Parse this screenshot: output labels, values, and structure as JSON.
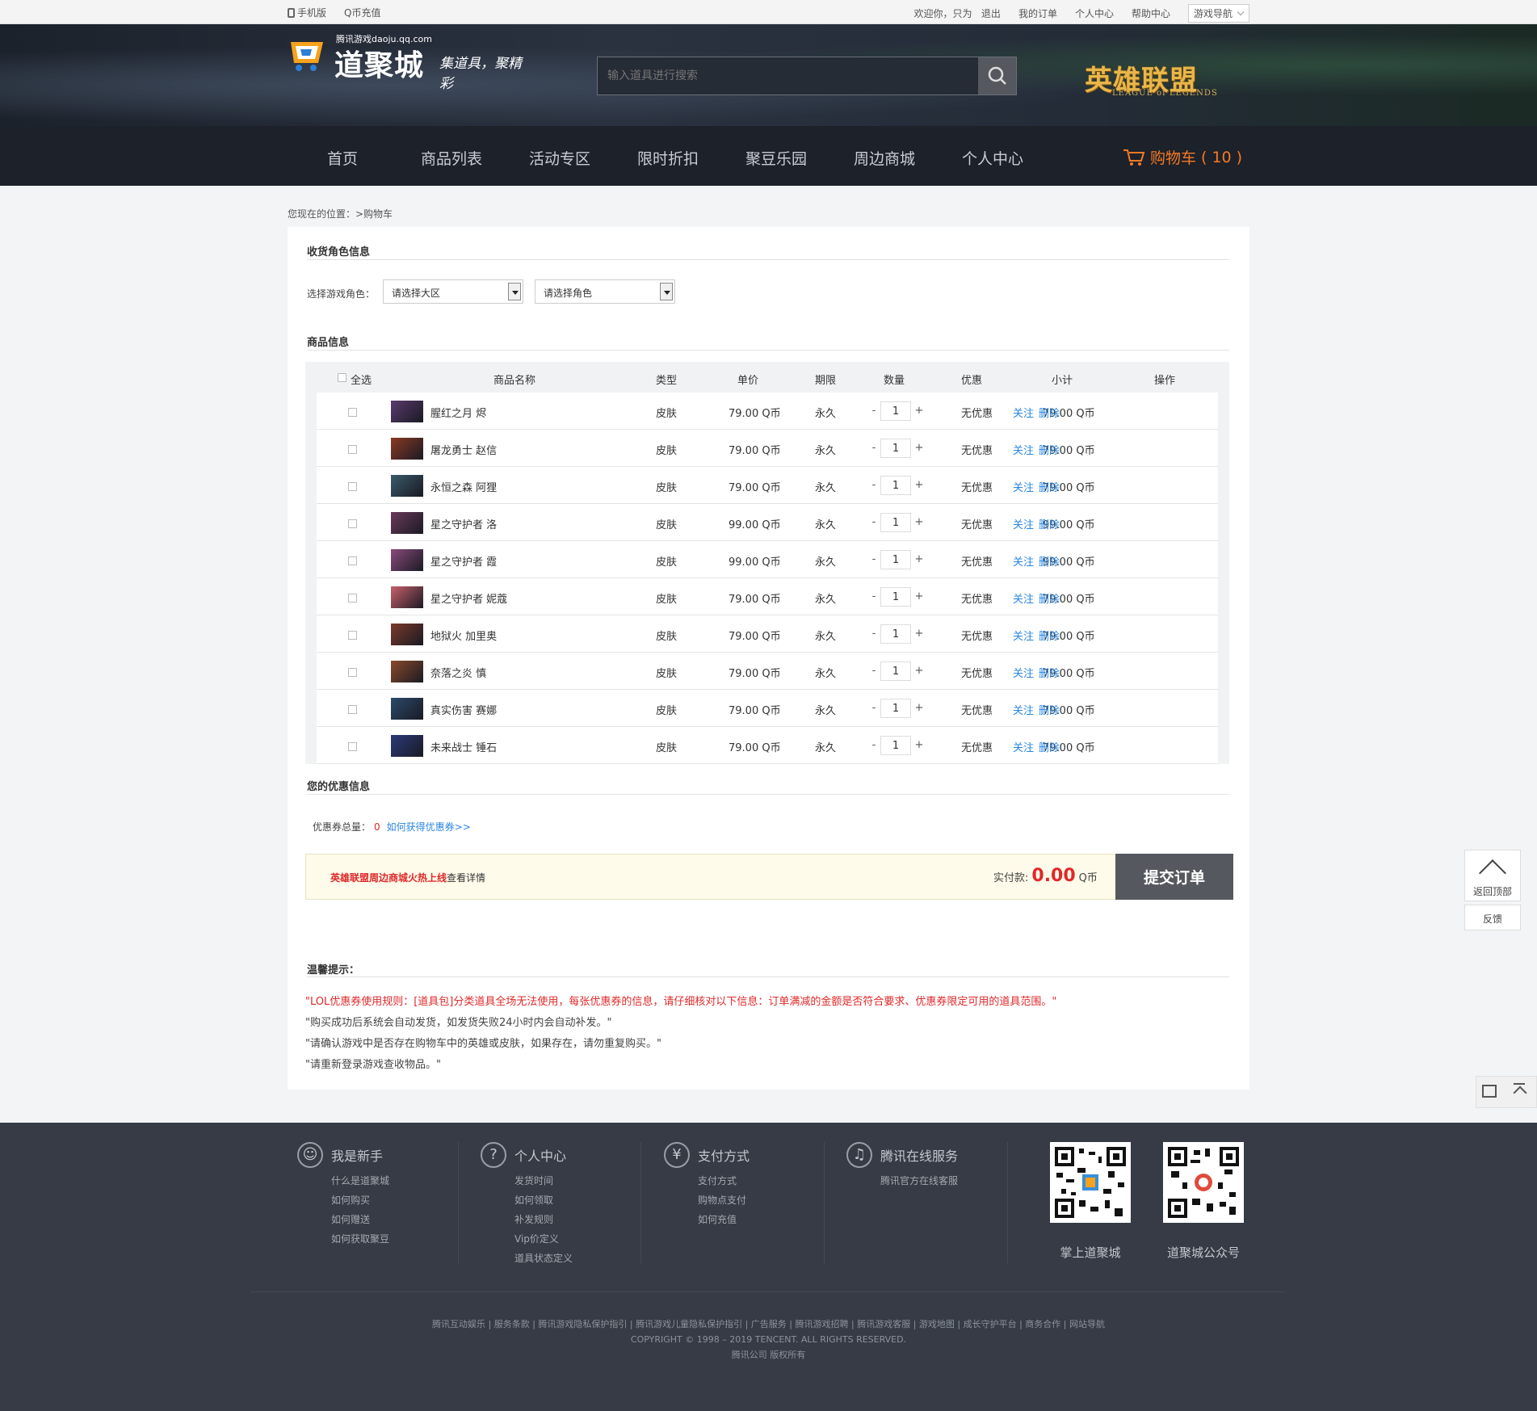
{
  "topbar": {
    "mobile": "手机版",
    "recharge": "Q币充值",
    "welcome": "欢迎你，只为",
    "logout": "退出",
    "my_orders": "我的订单",
    "personal": "个人中心",
    "help": "帮助中心",
    "game_nav": "游戏导航"
  },
  "header": {
    "site_url": "腾讯游戏daoju.qq.com",
    "site_name": "道聚城",
    "slogan": "集道具，聚精彩",
    "search_placeholder": "输入道具进行搜索",
    "game_logo": "英雄联盟",
    "game_logo_sub": "LEAGUE of LEGENDS"
  },
  "nav": {
    "items": [
      "首页",
      "商品列表",
      "活动专区",
      "限时折扣",
      "聚豆乐园",
      "周边商城",
      "个人中心"
    ],
    "cart_label": "购物车",
    "cart_count": "( 10 )"
  },
  "breadcrumb": "您现在的位置：>购物车",
  "role": {
    "section_title": "收货角色信息",
    "label": "选择游戏角色：",
    "region_select": "请选择大区",
    "role_select": "请选择角色"
  },
  "goods": {
    "section_title": "商品信息",
    "headers": {
      "select_all": "全选",
      "name": "商品名称",
      "type": "类型",
      "price": "单价",
      "term": "期限",
      "qty": "数量",
      "discount": "优惠",
      "subtotal": "小计",
      "ops": "操作"
    },
    "rows": [
      {
        "name": "腥红之月 烬",
        "type": "皮肤",
        "price": "79.00 Q币",
        "term": "永久",
        "qty": "1",
        "discount": "无优惠",
        "subtotal": "79.00 Q币",
        "follow": "关注",
        "delete": "删除"
      },
      {
        "name": "屠龙勇士 赵信",
        "type": "皮肤",
        "price": "79.00 Q币",
        "term": "永久",
        "qty": "1",
        "discount": "无优惠",
        "subtotal": "79.00 Q币",
        "follow": "关注",
        "delete": "删除"
      },
      {
        "name": "永恒之森 阿狸",
        "type": "皮肤",
        "price": "79.00 Q币",
        "term": "永久",
        "qty": "1",
        "discount": "无优惠",
        "subtotal": "79.00 Q币",
        "follow": "关注",
        "delete": "删除"
      },
      {
        "name": "星之守护者 洛",
        "type": "皮肤",
        "price": "99.00 Q币",
        "term": "永久",
        "qty": "1",
        "discount": "无优惠",
        "subtotal": "99.00 Q币",
        "follow": "关注",
        "delete": "删除"
      },
      {
        "name": "星之守护者 霞",
        "type": "皮肤",
        "price": "99.00 Q币",
        "term": "永久",
        "qty": "1",
        "discount": "无优惠",
        "subtotal": "99.00 Q币",
        "follow": "关注",
        "delete": "删除"
      },
      {
        "name": "星之守护者 妮蔻",
        "type": "皮肤",
        "price": "79.00 Q币",
        "term": "永久",
        "qty": "1",
        "discount": "无优惠",
        "subtotal": "79.00 Q币",
        "follow": "关注",
        "delete": "删除"
      },
      {
        "name": "地狱火 加里奥",
        "type": "皮肤",
        "price": "79.00 Q币",
        "term": "永久",
        "qty": "1",
        "discount": "无优惠",
        "subtotal": "79.00 Q币",
        "follow": "关注",
        "delete": "删除"
      },
      {
        "name": "奈落之炎 慎",
        "type": "皮肤",
        "price": "79.00 Q币",
        "term": "永久",
        "qty": "1",
        "discount": "无优惠",
        "subtotal": "79.00 Q币",
        "follow": "关注",
        "delete": "删除"
      },
      {
        "name": "真实伤害 赛娜",
        "type": "皮肤",
        "price": "79.00 Q币",
        "term": "永久",
        "qty": "1",
        "discount": "无优惠",
        "subtotal": "79.00 Q币",
        "follow": "关注",
        "delete": "删除"
      },
      {
        "name": "未来战士 锤石",
        "type": "皮肤",
        "price": "79.00 Q币",
        "term": "永久",
        "qty": "1",
        "discount": "无优惠",
        "subtotal": "79.00 Q币",
        "follow": "关注",
        "delete": "删除"
      }
    ],
    "thumb_colors": [
      "#5a3a6e",
      "#8a3a22",
      "#3a5a6a",
      "#6a3a5a",
      "#8a4a7a",
      "#c8606a",
      "#7a3a2a",
      "#8a4a2a",
      "#2a4a6a",
      "#2a3a7a"
    ]
  },
  "coupon": {
    "section_title": "您的优惠信息",
    "total_label": "优惠券总量：",
    "total": "0",
    "how_link": "如何获得优惠券>>"
  },
  "order": {
    "promo": "英雄联盟周边商城火热上线",
    "promo_link": "查看详情",
    "pay_label": "实付款:",
    "amount": "0.00",
    "currency": "Q币",
    "submit": "提交订单"
  },
  "tips": {
    "title": "温馨提示：",
    "lines": [
      "\"LOL优惠券使用规则：[道具包]分类道具全场无法使用，每张优惠券的信息，请仔细核对以下信息：订单满减的金额是否符合要求、优惠券限定可用的道具范围。\"",
      "\"购买成功后系统会自动发货，如发货失败24小时内会自动补发。\"",
      "\"请确认游戏中是否存在购物车中的英雄或皮肤，如果存在，请勿重复购买。\"",
      "\"请重新登录游戏查收物品。\""
    ]
  },
  "float": {
    "top": "返回顶部",
    "feedback": "反馈"
  },
  "footer": {
    "cols": [
      {
        "title": "我是新手",
        "icon": "user-icon",
        "items": [
          "什么是道聚城",
          "如何购买",
          "如何赠送",
          "如何获取聚豆"
        ]
      },
      {
        "title": "个人中心",
        "icon": "question-icon",
        "items": [
          "发货时间",
          "如何领取",
          "补发规则",
          "Vip价定义",
          "道具状态定义"
        ]
      },
      {
        "title": "支付方式",
        "icon": "yen-icon",
        "items": [
          "支付方式",
          "购物点支付",
          "如何充值"
        ]
      },
      {
        "title": "腾讯在线服务",
        "icon": "service-icon",
        "items": [
          "腾讯官方在线客服"
        ]
      }
    ],
    "qr1_label": "掌上道聚城",
    "qr2_label": "道聚城公众号",
    "links": "腾讯互动娱乐 | 服务条款 | 腾讯游戏隐私保护指引 | 腾讯游戏儿童隐私保护指引 | 广告服务 | 腾讯游戏招聘 | 腾讯游戏客服 | 游戏地图 | 成长守护平台 | 商务合作 | 网站导航",
    "copyright": "COPYRIGHT © 1998 – 2019 TENCENT. ALL RIGHTS RESERVED.",
    "company": "腾讯公司 版权所有"
  },
  "colors": {
    "accent_orange": "#f57a26",
    "price_red": "#e0282a",
    "link_blue": "#2a86e0",
    "nav_bg": "#1d2129",
    "footer_bg": "#363b45"
  }
}
